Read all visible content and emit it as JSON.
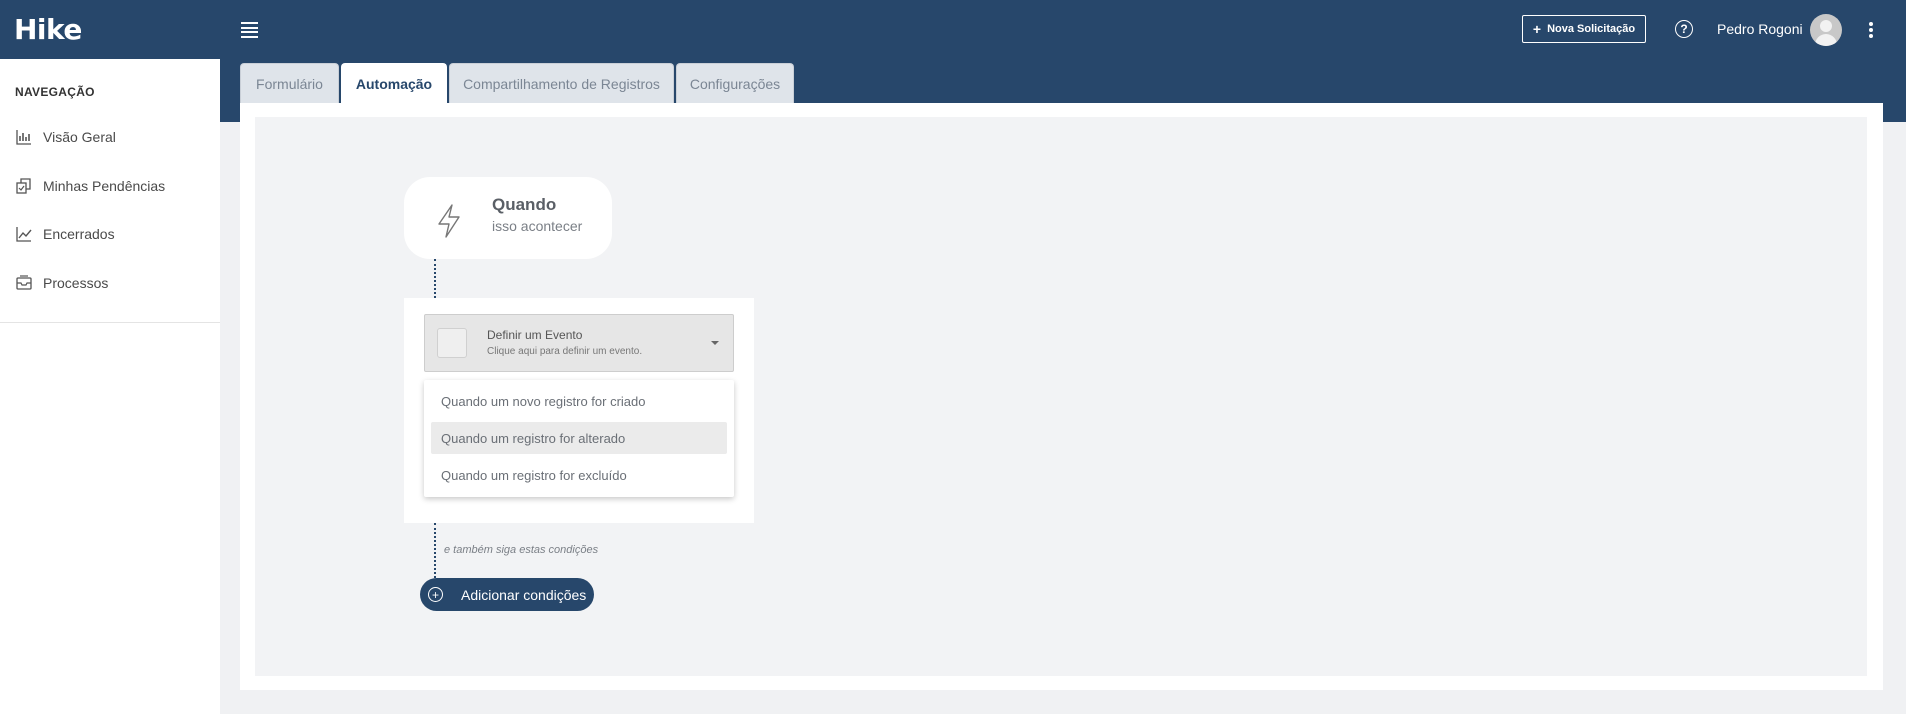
{
  "header": {
    "logo": "Hike",
    "new_request_label": "Nova Solicitação",
    "help_symbol": "?",
    "user_name": "Pedro Rogoni",
    "background_color": "#27476b"
  },
  "sidebar": {
    "title": "NAVEGAÇÃO",
    "items": [
      {
        "label": "Visão Geral",
        "icon": "bar-chart-icon"
      },
      {
        "label": "Minhas Pendências",
        "icon": "tasks-icon"
      },
      {
        "label": "Encerrados",
        "icon": "trend-line-icon"
      },
      {
        "label": "Processos",
        "icon": "inbox-icon"
      }
    ]
  },
  "tabs": [
    {
      "label": "Formulário",
      "active": false
    },
    {
      "label": "Automação",
      "active": true
    },
    {
      "label": "Compartilhamento de Registros",
      "active": false
    },
    {
      "label": "Configurações",
      "active": false
    }
  ],
  "trigger": {
    "title": "Quando",
    "subtitle": "isso acontecer",
    "icon": "lightning-icon"
  },
  "event_select": {
    "title": "Definir um Evento",
    "hint": "Clique aqui para definir um evento."
  },
  "event_options": [
    "Quando um novo registro for criado",
    "Quando um registro for alterado",
    "Quando um registro for excluído"
  ],
  "conditions": {
    "hint": "e também siga estas condições",
    "add_label": "Adicionar condições"
  }
}
